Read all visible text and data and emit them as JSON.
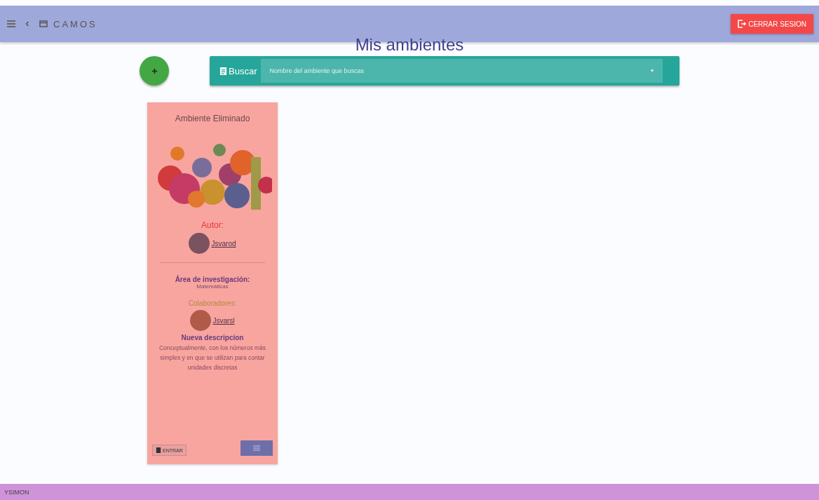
{
  "header": {
    "brand": "CAMOS",
    "logout_button": "CERRAR SESION"
  },
  "page": {
    "title": "Mis ambientes"
  },
  "search": {
    "label": "Buscar",
    "placeholder": "Nombre del ambiente que buscas"
  },
  "cards": [
    {
      "title": "Ambiente Eliminado",
      "author_label": "Autor:",
      "author": "Jsvarod",
      "area_label": "Área de investigación:",
      "area": "Matemáticas",
      "collaborators_label": "Colaboradores:",
      "collaborator": "Jsvarsl",
      "description_title": "Nueva descripcion",
      "description": "Conceptualmente, con los números más simples y en que se utilizan para contar unidades discretas",
      "enter_button": "ENTRAR"
    }
  ],
  "footer": {
    "user": "YSIMON"
  }
}
